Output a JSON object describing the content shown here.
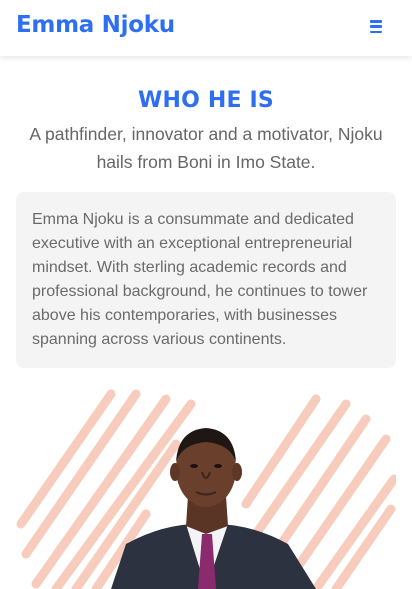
{
  "navbar": {
    "brand": "Emma Njoku",
    "menu_icon": "hamburger-menu-icon"
  },
  "about": {
    "heading": "WHO HE IS",
    "tagline": "A pathfinder, innovator and a motivator, Njoku hails from Boni in Imo State.",
    "bio": "Emma Njoku is a consummate and dedicated executive with an exceptional entrepreneurial mindset. With sterling academic records and professional background, he continues to tower above his contemporaries, with businesses spanning across various continents."
  },
  "colors": {
    "brand_blue": "#2e6ff2",
    "card_bg": "#f4f4f4",
    "brush_strokes": "#f8c7b5",
    "suit": "#2d3240",
    "tie": "#8c2a6e"
  }
}
